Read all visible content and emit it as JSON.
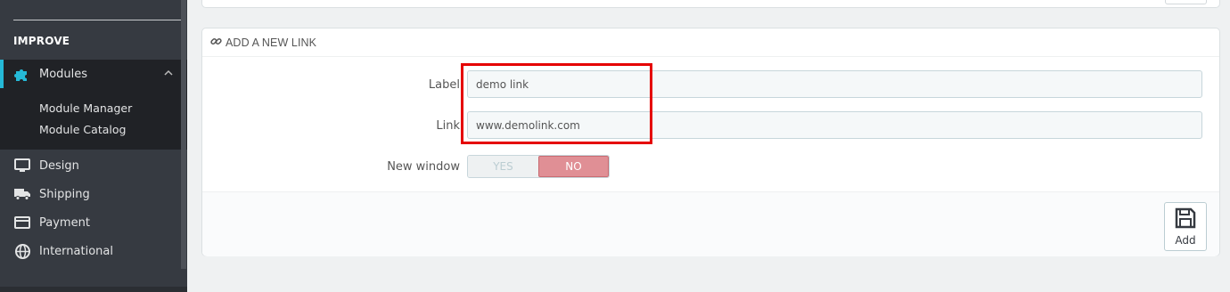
{
  "sidebar": {
    "section_title": "IMPROVE",
    "active_item": {
      "label": "Modules",
      "icon": "puzzle-icon"
    },
    "sub_items": [
      "Module Manager",
      "Module Catalog"
    ],
    "items": [
      {
        "label": "Design",
        "icon": "monitor-icon"
      },
      {
        "label": "Shipping",
        "icon": "truck-icon"
      },
      {
        "label": "Payment",
        "icon": "credit-card-icon"
      },
      {
        "label": "International",
        "icon": "globe-icon"
      }
    ]
  },
  "panel": {
    "title": "ADD A NEW LINK",
    "title_icon": "link-icon",
    "fields": {
      "label": {
        "label": "Label",
        "value": "demo link"
      },
      "link": {
        "label": "Link",
        "value": "www.demolink.com"
      },
      "new_window": {
        "label": "New window",
        "options": [
          "YES",
          "NO"
        ],
        "selected": "NO"
      }
    },
    "save_button": {
      "label": "Add",
      "icon": "floppy-disk-icon"
    }
  },
  "colors": {
    "sidebar_bg": "#363a41",
    "accent": "#25b9d7",
    "switch_selected": "#e08f95",
    "highlight": "#e50000"
  }
}
